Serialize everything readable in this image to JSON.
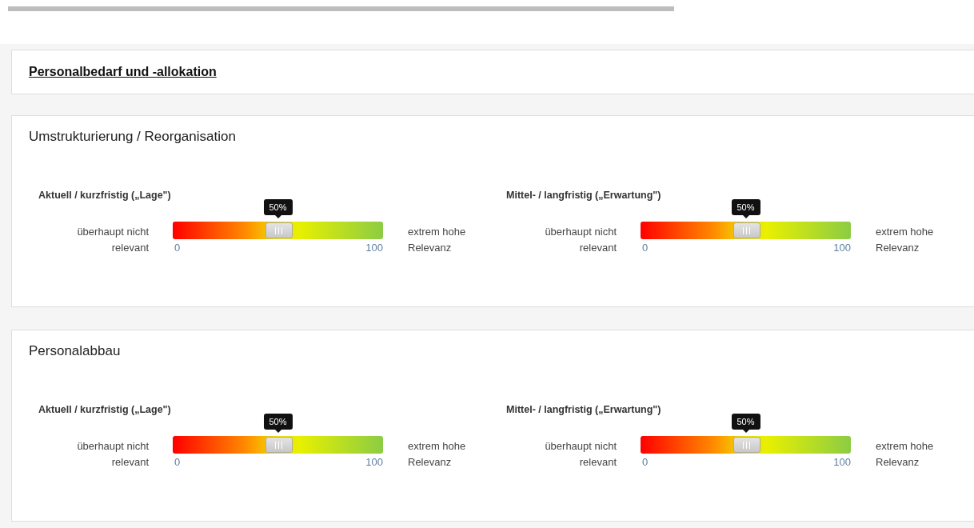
{
  "header": {
    "title": "Personalbedarf und -allokation"
  },
  "sections": [
    {
      "title": "Umstrukturierung / Reorganisation",
      "sliders": [
        {
          "label": "Aktuell / kurzfristig („Lage\")",
          "tooltip": "50%",
          "level": 0.5,
          "min_label": "überhaupt nicht relevant",
          "max_label": "extrem hohe Relevanz",
          "min": "0",
          "max": "100"
        },
        {
          "label": "Mittel- / langfristig („Erwartung\")",
          "tooltip": "50%",
          "level": 0.5,
          "min_label": "überhaupt nicht relevant",
          "max_label": "extrem hohe Relevanz",
          "min": "0",
          "max": "100"
        }
      ]
    },
    {
      "title": "Personalabbau",
      "sliders": [
        {
          "label": "Aktuell / kurzfristig („Lage\")",
          "tooltip": "50%",
          "level": 0.5,
          "min_label": "überhaupt nicht relevant",
          "max_label": "extrem hohe Relevanz",
          "min": "0",
          "max": "100"
        },
        {
          "label": "Mittel- / langfristig („Erwartung\")",
          "tooltip": "50%",
          "level": 0.5,
          "min_label": "überhaupt nicht relevant",
          "max_label": "extrem hohe Relevanz",
          "min": "0",
          "max": "100"
        }
      ]
    }
  ]
}
